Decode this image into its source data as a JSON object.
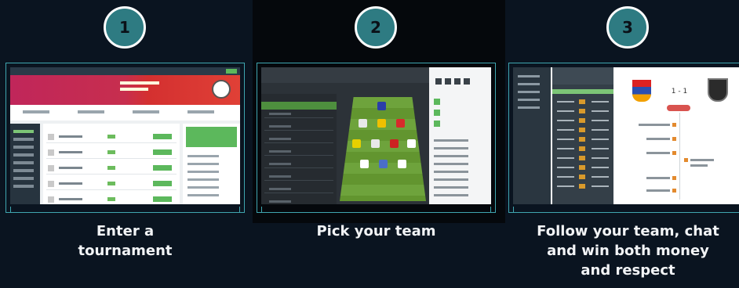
{
  "steps": [
    {
      "number": "1",
      "caption_line1": "Enter a",
      "caption_line2": "tournament",
      "screenshot": "tournament-lobby-screenshot"
    },
    {
      "number": "2",
      "caption_line1": "Pick your team",
      "caption_line2": "",
      "screenshot": "team-picker-screenshot"
    },
    {
      "number": "3",
      "caption_line1": "Follow your team, chat",
      "caption_line2": "and win both money",
      "caption_line3": "and respect",
      "screenshot": "live-match-screenshot"
    }
  ],
  "colors": {
    "background": "#0a1420",
    "badge": "#2e7b82",
    "frame_border": "#3fa6b0",
    "caption": "#f2f4f6"
  },
  "live_match": {
    "score": "1 - 1"
  }
}
